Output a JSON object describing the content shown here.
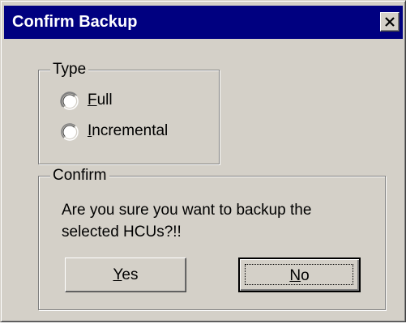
{
  "dialog": {
    "title": "Confirm Backup",
    "close_icon": "close-x-icon"
  },
  "type_group": {
    "legend": "Type",
    "options": [
      {
        "label": "Full",
        "mnemonic": "F",
        "selected": false
      },
      {
        "label": "Incremental",
        "mnemonic": "I",
        "selected": false
      }
    ]
  },
  "confirm_group": {
    "legend": "Confirm",
    "message": "Are you sure you want to backup the selected HCUs?!!"
  },
  "buttons": {
    "yes": {
      "label": "Yes",
      "mnemonic": "Y"
    },
    "no": {
      "label": "No",
      "mnemonic": "N",
      "default": true
    }
  },
  "colors": {
    "titlebar": "#000080",
    "face": "#d4d0c8"
  }
}
